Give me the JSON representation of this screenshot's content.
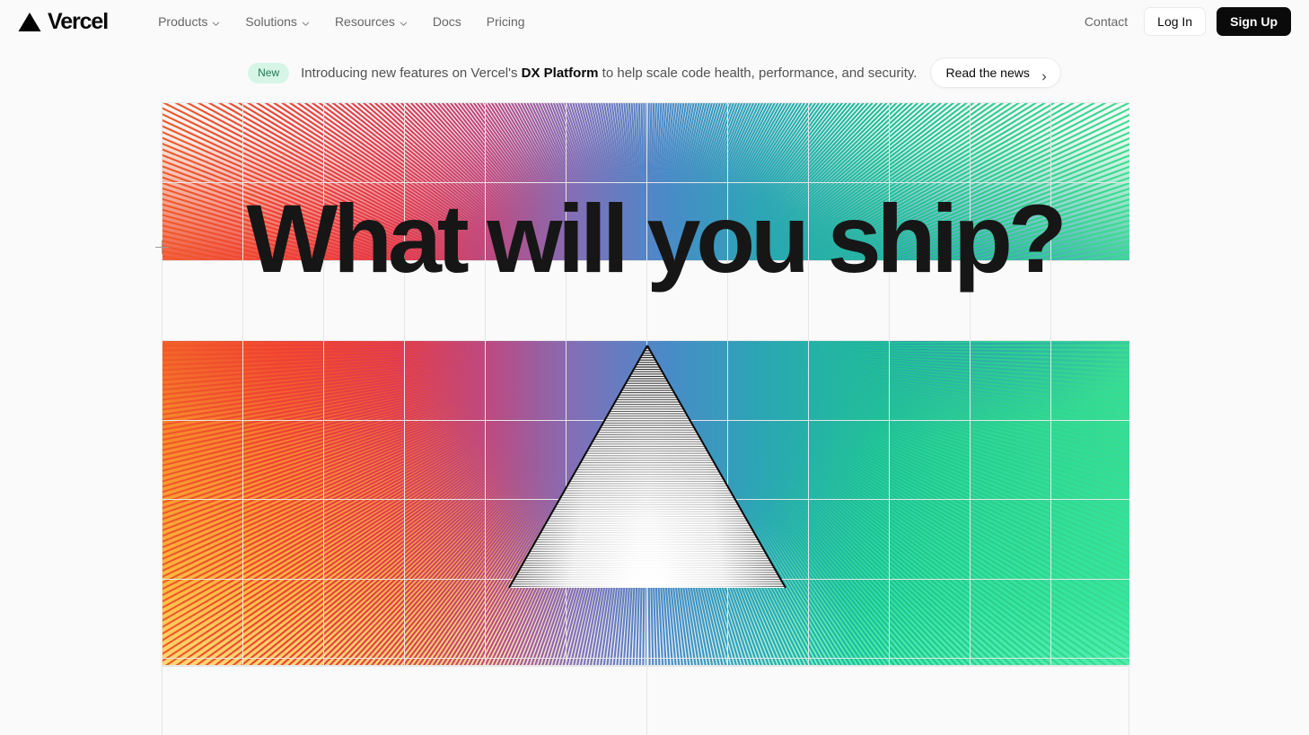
{
  "brand": {
    "name": "Vercel",
    "logo_icon": "vercel-triangle-logo"
  },
  "nav": {
    "items": [
      {
        "label": "Products",
        "has_dropdown": true,
        "icon": "chevron-down-icon"
      },
      {
        "label": "Solutions",
        "has_dropdown": true,
        "icon": "chevron-down-icon"
      },
      {
        "label": "Resources",
        "has_dropdown": true,
        "icon": "chevron-down-icon"
      },
      {
        "label": "Docs",
        "has_dropdown": false,
        "icon": ""
      },
      {
        "label": "Pricing",
        "has_dropdown": false,
        "icon": ""
      }
    ]
  },
  "header_actions": {
    "contact_label": "Contact",
    "login_label": "Log In",
    "signup_label": "Sign Up"
  },
  "announcement": {
    "badge": "New",
    "text_before": "Introducing new features on Vercel's ",
    "text_strong": "DX Platform",
    "text_after": " to help scale code health, performance, and security.",
    "cta_label": "Read the news",
    "cta_icon": "chevron-right-icon",
    "badge_bg": "#d6f5e6",
    "badge_fg": "#1f7a54"
  },
  "hero": {
    "headline": "What will you ship?",
    "graphic_name": "prism-light-refraction-graphic",
    "crosshair_icon": "crosshair-marker-icon"
  },
  "colors": {
    "page_background": "#fafafa",
    "text_primary": "#0a0a0a",
    "text_secondary": "#666666",
    "border": "#eaeaea",
    "accent_red": "#ef4136",
    "accent_orange": "#f05a28",
    "accent_yellow": "#ffba2e",
    "accent_blue": "#2a6ec8",
    "accent_teal": "#23b89a",
    "accent_green": "#3ddc91",
    "grid_line": "#ebebeb"
  }
}
